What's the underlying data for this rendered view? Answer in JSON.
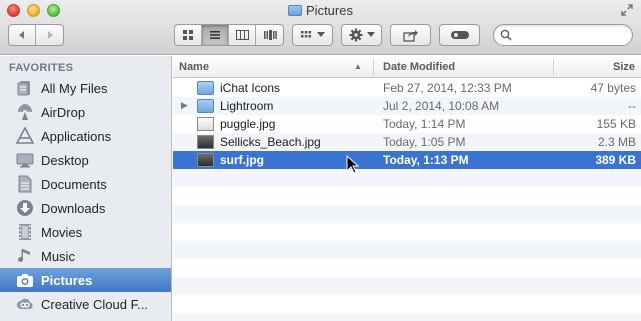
{
  "window": {
    "title": "Pictures",
    "title_icon": "folder-icon"
  },
  "toolbar": {
    "back_icon": "back-arrow-icon",
    "forward_icon": "forward-arrow-icon",
    "view_modes": [
      "icon-view-icon",
      "list-view-icon",
      "column-view-icon",
      "cover-flow-view-icon"
    ],
    "active_view": "list-view-icon",
    "arrange_icon": "arrange-grid-icon",
    "action_icon": "gear-icon",
    "share_icon": "share-icon",
    "tags_icon": "tag-toggle-icon",
    "search": {
      "value": "",
      "placeholder": ""
    }
  },
  "sidebar": {
    "heading": "FAVORITES",
    "items": [
      {
        "label": "All My Files",
        "icon": "all-files-icon"
      },
      {
        "label": "AirDrop",
        "icon": "airdrop-icon"
      },
      {
        "label": "Applications",
        "icon": "applications-icon"
      },
      {
        "label": "Desktop",
        "icon": "desktop-icon"
      },
      {
        "label": "Documents",
        "icon": "documents-icon"
      },
      {
        "label": "Downloads",
        "icon": "downloads-icon"
      },
      {
        "label": "Movies",
        "icon": "movies-icon"
      },
      {
        "label": "Music",
        "icon": "music-icon"
      },
      {
        "label": "Pictures",
        "icon": "camera-icon",
        "selected": true
      },
      {
        "label": "Creative Cloud F...",
        "icon": "creative-cloud-icon"
      }
    ]
  },
  "columns": {
    "name": "Name",
    "date": "Date Modified",
    "size": "Size",
    "sort": "ascending"
  },
  "files": [
    {
      "name": "iChat Icons",
      "date": "Feb 27, 2014, 12:33 PM",
      "size": "47 bytes",
      "kind": "folder-alias"
    },
    {
      "name": "Lightroom",
      "date": "Jul 2, 2014, 10:08 AM",
      "size": "--",
      "kind": "folder"
    },
    {
      "name": "puggle.jpg",
      "date": "Today, 1:14 PM",
      "size": "155 KB",
      "kind": "image"
    },
    {
      "name": "Sellicks_Beach.jpg",
      "date": "Today, 1:05 PM",
      "size": "2.3 MB",
      "kind": "image"
    },
    {
      "name": "surf.jpg",
      "date": "Today, 1:13 PM",
      "size": "389 KB",
      "kind": "image",
      "selected": true
    }
  ],
  "colors": {
    "selection": "#3b73d1",
    "sidebar_bg": "#e8ecf0",
    "row_alt": "#f2f5fa"
  }
}
